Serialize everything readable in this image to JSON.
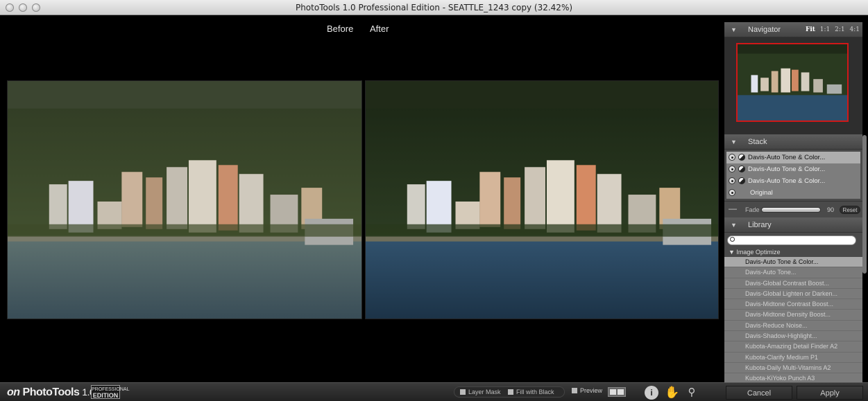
{
  "window": {
    "title": "PhotoTools 1.0 Professional Edition - SEATTLE_1243 copy (32.42%)"
  },
  "preview": {
    "before_label": "Before",
    "after_label": "After"
  },
  "navigator": {
    "title": "Navigator",
    "zoom_fit": "Fit",
    "zoom_1": "1:1",
    "zoom_2": "2:1",
    "zoom_4": "4:1"
  },
  "stack": {
    "title": "Stack",
    "items": [
      {
        "label": "Davis-Auto Tone & Color..."
      },
      {
        "label": "Davis-Auto Tone & Color..."
      },
      {
        "label": "Davis-Auto Tone & Color..."
      },
      {
        "label": "Original"
      }
    ],
    "fade_label": "Fade",
    "fade_value": "90",
    "fade_level": 0.9,
    "reset_label": "Reset"
  },
  "library": {
    "title": "Library",
    "search_placeholder": "",
    "category": "Image Optimize",
    "items": [
      "Davis-Auto Tone & Color...",
      "Davis-Auto Tone...",
      "Davis-Global Contrast Boost...",
      "Davis-Global Lighten or Darken...",
      "Davis-Midtone Contrast Boost...",
      "Davis-Midtone Density Boost...",
      "Davis-Reduce Noise...",
      "Davis-Shadow-Highlight...",
      "Kubota-Amazing Detail Finder A2",
      "Kubota-Clarify Medium P1",
      "Kubota-Daily Multi-Vitamins A2",
      "Kubota-KiYoko Punch A3"
    ]
  },
  "bottombar": {
    "brand_on": "on",
    "brand_name": "PhotoTools",
    "brand_version": "1.0",
    "edition_top": "PROFESSIONAL",
    "edition_bottom": "EDITION",
    "layer_mask": "Layer Mask",
    "fill_black": "Fill with Black",
    "preview": "Preview",
    "cancel": "Cancel",
    "apply": "Apply"
  },
  "colors": {
    "accent_red": "#d01818",
    "panel": "#4a4a4a"
  }
}
